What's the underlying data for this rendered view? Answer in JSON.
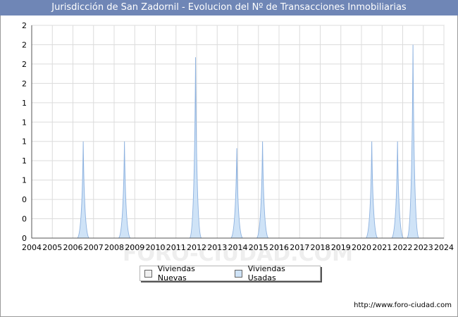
{
  "chart_data": {
    "type": "area",
    "title": "Jurisdicción de San Zadornil - Evolucion del Nº de Transacciones Inmobiliarias",
    "xlabel": "",
    "ylabel": "",
    "categories": [
      "2004",
      "2005",
      "2006",
      "2007",
      "2008",
      "2009",
      "2010",
      "2011",
      "2012",
      "2013",
      "2014",
      "2015",
      "2016",
      "2017",
      "2018",
      "2019",
      "2020",
      "2021",
      "2022",
      "2023",
      "2024"
    ],
    "ytick_labels": [
      "0",
      "0",
      "0",
      "1",
      "1",
      "1",
      "1",
      "1",
      "2",
      "2",
      "2",
      "2"
    ],
    "ylim": [
      0,
      2.2
    ],
    "grid": true,
    "legend_position": "bottom",
    "series": [
      {
        "name": "Viviendas Nuevas",
        "color": "#f0f0f0",
        "points": []
      },
      {
        "name": "Viviendas Usadas",
        "color": "#cfe3f7",
        "points": [
          {
            "x": 2006.5,
            "y": 1.0
          },
          {
            "x": 2008.5,
            "y": 1.0
          },
          {
            "x": 2011.95,
            "y": 1.87
          },
          {
            "x": 2013.95,
            "y": 0.93
          },
          {
            "x": 2015.2,
            "y": 1.0
          },
          {
            "x": 2020.5,
            "y": 1.0
          },
          {
            "x": 2021.75,
            "y": 1.0
          },
          {
            "x": 2022.5,
            "y": 2.0
          }
        ]
      }
    ]
  },
  "footer": {
    "url": "http://www.foro-ciudad.com"
  },
  "watermark": "FORO-CIUDAD.COM"
}
